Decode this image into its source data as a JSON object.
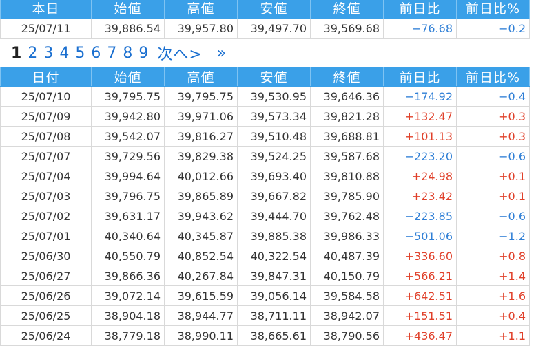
{
  "columns": [
    "本日",
    "始値",
    "高値",
    "安値",
    "終値",
    "前日比",
    "前日比%"
  ],
  "today_row": {
    "date": "25/07/11",
    "open": "39,886.54",
    "high": "39,957.80",
    "low": "39,497.70",
    "close": "39,569.68",
    "change": "-76.68",
    "pct": "-0.2"
  },
  "pagination": {
    "current": "1",
    "pages": [
      "2",
      "3",
      "4",
      "5",
      "6",
      "7",
      "8",
      "9"
    ],
    "next_label": "次へ>",
    "last_label": "»"
  },
  "history_columns": [
    "日付",
    "始値",
    "高値",
    "安値",
    "終値",
    "前日比",
    "前日比%"
  ],
  "rows": [
    {
      "date": "25/07/10",
      "open": "39,795.75",
      "high": "39,795.75",
      "low": "39,530.95",
      "close": "39,646.36",
      "change": "-174.92",
      "pct": "-0.4"
    },
    {
      "date": "25/07/09",
      "open": "39,942.80",
      "high": "39,971.06",
      "low": "39,573.34",
      "close": "39,821.28",
      "change": "+132.47",
      "pct": "+0.3"
    },
    {
      "date": "25/07/08",
      "open": "39,542.07",
      "high": "39,816.27",
      "low": "39,510.48",
      "close": "39,688.81",
      "change": "+101.13",
      "pct": "+0.3"
    },
    {
      "date": "25/07/07",
      "open": "39,729.56",
      "high": "39,829.38",
      "low": "39,524.25",
      "close": "39,587.68",
      "change": "-223.20",
      "pct": "-0.6"
    },
    {
      "date": "25/07/04",
      "open": "39,994.64",
      "high": "40,012.66",
      "low": "39,693.40",
      "close": "39,810.88",
      "change": "+24.98",
      "pct": "+0.1"
    },
    {
      "date": "25/07/03",
      "open": "39,796.75",
      "high": "39,865.89",
      "low": "39,667.82",
      "close": "39,785.90",
      "change": "+23.42",
      "pct": "+0.1"
    },
    {
      "date": "25/07/02",
      "open": "39,631.17",
      "high": "39,943.62",
      "low": "39,444.70",
      "close": "39,762.48",
      "change": "-223.85",
      "pct": "-0.6"
    },
    {
      "date": "25/07/01",
      "open": "40,340.64",
      "high": "40,345.87",
      "low": "39,885.38",
      "close": "39,986.33",
      "change": "-501.06",
      "pct": "-1.2"
    },
    {
      "date": "25/06/30",
      "open": "40,550.79",
      "high": "40,852.54",
      "low": "40,322.54",
      "close": "40,487.39",
      "change": "+336.60",
      "pct": "+0.8"
    },
    {
      "date": "25/06/27",
      "open": "39,866.36",
      "high": "40,267.84",
      "low": "39,847.31",
      "close": "40,150.79",
      "change": "+566.21",
      "pct": "+1.4"
    },
    {
      "date": "25/06/26",
      "open": "39,072.14",
      "high": "39,615.59",
      "low": "39,056.14",
      "close": "39,584.58",
      "change": "+642.51",
      "pct": "+1.6"
    },
    {
      "date": "25/06/25",
      "open": "38,904.18",
      "high": "38,944.77",
      "low": "38,711.11",
      "close": "38,942.07",
      "change": "+151.51",
      "pct": "+0.4"
    },
    {
      "date": "25/06/24",
      "open": "38,779.18",
      "high": "38,990.11",
      "low": "38,665.61",
      "close": "38,790.56",
      "change": "+436.47",
      "pct": "+1.1"
    }
  ],
  "colors": {
    "header_bg": "#3aa0e8",
    "negative": "#2f7fd6",
    "positive": "#e0402a",
    "link": "#1a6fd0"
  }
}
